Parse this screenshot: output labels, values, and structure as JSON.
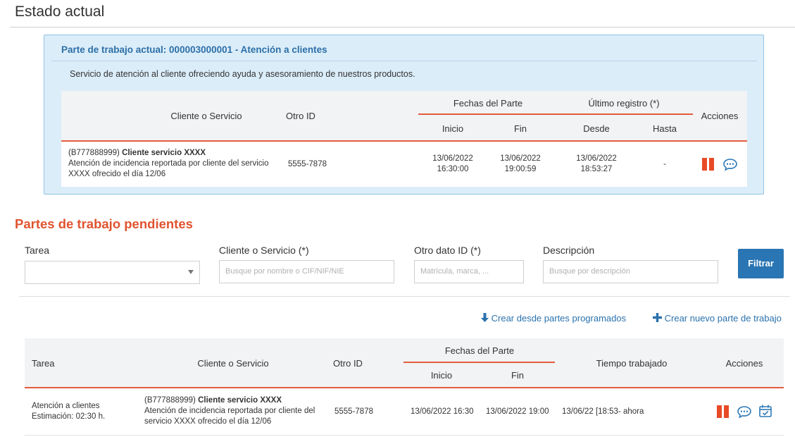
{
  "header": {
    "title": "Estado actual"
  },
  "current": {
    "title": "Parte de trabajo actual: 000003000001 - Atención a clientes",
    "description": "Servicio de atención al cliente ofreciendo ayuda y asesoramiento de nuestros productos.",
    "columns": {
      "client": "Cliente o Servicio",
      "other_id": "Otro ID",
      "dates_group": "Fechas del Parte",
      "start": "Inicio",
      "end": "Fin",
      "last_group": "Último registro (*)",
      "from": "Desde",
      "to": "Hasta",
      "actions": "Acciones"
    },
    "row": {
      "client_code": "(B777888999)",
      "client_name": "Cliente servicio XXXX",
      "client_desc_1": "Atención de incidencia reportada por cliente del servicio",
      "client_desc_2": "XXXX ofrecido el día 12/06",
      "other_id": "5555-7878",
      "start_date": "13/06/2022",
      "start_time": "16:30:00",
      "end_date": "13/06/2022",
      "end_time": "19:00:59",
      "from_date": "13/06/2022",
      "from_time": "18:53:27",
      "to": "-"
    }
  },
  "pending": {
    "title": "Partes de trabajo pendientes",
    "filters": {
      "task_label": "Tarea",
      "task_value": "",
      "client_label": "Cliente o Servicio (*)",
      "client_placeholder": "Busque por nombre o CIF/NIF/NIE",
      "other_label": "Otro dato ID (*)",
      "other_placeholder": "Matrícula, marca, ...",
      "desc_label": "Descripción",
      "desc_placeholder": "Busque por descripción",
      "filter_button": "Filtrar"
    },
    "links": {
      "from_scheduled": "Crear desde partes programados",
      "new_part": "Crear nuevo parte de trabajo"
    },
    "columns": {
      "task": "Tarea",
      "client": "Cliente o Servicio",
      "other_id": "Otro ID",
      "dates_group": "Fechas del Parte",
      "start": "Inicio",
      "end": "Fin",
      "time_worked": "Tiempo trabajado",
      "actions": "Acciones"
    },
    "rows": [
      {
        "task": "Atención a clientes",
        "estimate": "Estimación: 02:30 h.",
        "client_code": "(B777888999)",
        "client_name": "Cliente servicio XXXX",
        "client_desc_1": "Atención de incidencia reportada por cliente del",
        "client_desc_2": "servicio XXXX ofrecido el día 12/06",
        "other_id": "5555-7878",
        "start": "13/06/2022 16:30",
        "end": "13/06/2022 19:00",
        "time_worked": "13/06/22 [18:53- ahora"
      }
    ]
  },
  "colors": {
    "accent": "#e55b3c",
    "primary": "#2a75b3",
    "panel_bg": "#dbedf9"
  }
}
